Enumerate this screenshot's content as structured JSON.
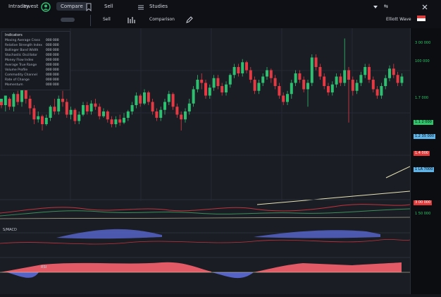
{
  "toolbar": {
    "tab_1": "Intraday",
    "tab_2": "Invest",
    "button": "Compare",
    "tab_3": "Sell",
    "tab_4": "Studies",
    "tab_5": "Comparison",
    "right_label": "Elliott Wave"
  },
  "info_panel": {
    "title": "Indicators",
    "rows": [
      {
        "label": "Moving Average Cross",
        "value": "000 000"
      },
      {
        "label": "Relative Strength Index",
        "value": "000 000"
      },
      {
        "label": "Bollinger Band Width",
        "value": "000 000"
      },
      {
        "label": "Stochastic Oscillator",
        "value": "000 000"
      },
      {
        "label": "Money Flow Index",
        "value": "000 000"
      },
      {
        "label": "Average True Range",
        "value": "000 000"
      },
      {
        "label": "Volume Profile",
        "value": "000 000"
      },
      {
        "label": "Commodity Channel",
        "value": "000 000"
      },
      {
        "label": "Rate of Change",
        "value": "000 000"
      },
      {
        "label": "Momentum",
        "value": "000 000"
      }
    ]
  },
  "price_scale": {
    "labels": [
      {
        "text": "3 00 000",
        "color": "#2ec46a",
        "bg": "#0b0d10"
      },
      {
        "text": "100 000",
        "color": "#2ec46a",
        "bg": "#0b0d10"
      },
      {
        "text": "1.7 000",
        "color": "#2ec46a",
        "bg": "#0b0d10"
      },
      {
        "text": "1.1 2 000",
        "color": "#0b0d10",
        "bg": "#2ec46a"
      },
      {
        "text": "1.2 35 000",
        "color": "#0b0d10",
        "bg": "#5fb3e6"
      },
      {
        "text": "1.4 000",
        "color": "#ffffff",
        "bg": "#e03a3a"
      },
      {
        "text": "1 LA 7000",
        "color": "#0b0d10",
        "bg": "#5fb3e6"
      },
      {
        "text": "3 00 000",
        "color": "#ffffff",
        "bg": "#e03a3a"
      },
      {
        "text": "1 50 000",
        "color": "#2ec46a",
        "bg": "#0b0d10"
      }
    ]
  },
  "sub_panels": {
    "osc_label": "S/MACD",
    "rsi_label": "RSI"
  },
  "colors": {
    "up": "#2fbf71",
    "down": "#e33a44",
    "line_up": "#3b8f5a",
    "line_down": "#c2333d",
    "fill_blue": "#5563c7",
    "fill_red": "#e25a66",
    "trend": "#e7e3b5"
  },
  "chart_data": {
    "type": "candlestick",
    "candles": [
      [
        0.0,
        0.57,
        0.6,
        0.55,
        0.58
      ],
      [
        0.0,
        0.58,
        0.56,
        0.54,
        0.57
      ],
      [
        0.01,
        0.56,
        0.62,
        0.52,
        0.6
      ],
      [
        0.02,
        0.6,
        0.55,
        0.53,
        0.61
      ],
      [
        0.03,
        0.55,
        0.63,
        0.52,
        0.64
      ],
      [
        0.04,
        0.63,
        0.58,
        0.56,
        0.65
      ],
      [
        0.05,
        0.58,
        0.66,
        0.55,
        0.67
      ],
      [
        0.06,
        0.66,
        0.6,
        0.57,
        0.67
      ],
      [
        0.07,
        0.6,
        0.54,
        0.5,
        0.62
      ],
      [
        0.08,
        0.54,
        0.47,
        0.44,
        0.56
      ],
      [
        0.09,
        0.47,
        0.49,
        0.45,
        0.52
      ],
      [
        0.1,
        0.49,
        0.44,
        0.4,
        0.5
      ],
      [
        0.11,
        0.44,
        0.48,
        0.43,
        0.5
      ],
      [
        0.12,
        0.48,
        0.55,
        0.46,
        0.56
      ],
      [
        0.13,
        0.55,
        0.52,
        0.5,
        0.6
      ],
      [
        0.14,
        0.52,
        0.6,
        0.5,
        0.62
      ],
      [
        0.15,
        0.6,
        0.58,
        0.55,
        0.65
      ],
      [
        0.16,
        0.58,
        0.5,
        0.48,
        0.6
      ],
      [
        0.17,
        0.5,
        0.53,
        0.47,
        0.55
      ],
      [
        0.18,
        0.53,
        0.46,
        0.44,
        0.54
      ],
      [
        0.19,
        0.46,
        0.5,
        0.44,
        0.52
      ],
      [
        0.2,
        0.5,
        0.56,
        0.49,
        0.58
      ],
      [
        0.21,
        0.56,
        0.52,
        0.5,
        0.58
      ],
      [
        0.22,
        0.52,
        0.57,
        0.5,
        0.59
      ],
      [
        0.23,
        0.57,
        0.55,
        0.53,
        0.6
      ],
      [
        0.24,
        0.55,
        0.49,
        0.47,
        0.57
      ],
      [
        0.25,
        0.49,
        0.52,
        0.48,
        0.54
      ],
      [
        0.26,
        0.52,
        0.47,
        0.45,
        0.53
      ],
      [
        0.27,
        0.47,
        0.44,
        0.42,
        0.49
      ],
      [
        0.28,
        0.44,
        0.47,
        0.42,
        0.49
      ],
      [
        0.29,
        0.47,
        0.45,
        0.43,
        0.5
      ],
      [
        0.3,
        0.45,
        0.48,
        0.44,
        0.51
      ],
      [
        0.31,
        0.48,
        0.52,
        0.46,
        0.53
      ],
      [
        0.32,
        0.52,
        0.56,
        0.5,
        0.58
      ],
      [
        0.33,
        0.56,
        0.62,
        0.54,
        0.64
      ],
      [
        0.34,
        0.62,
        0.57,
        0.55,
        0.63
      ],
      [
        0.35,
        0.57,
        0.64,
        0.56,
        0.66
      ],
      [
        0.36,
        0.64,
        0.58,
        0.56,
        0.65
      ],
      [
        0.37,
        0.58,
        0.52,
        0.5,
        0.6
      ],
      [
        0.38,
        0.52,
        0.48,
        0.46,
        0.54
      ],
      [
        0.39,
        0.48,
        0.53,
        0.46,
        0.55
      ],
      [
        0.4,
        0.53,
        0.58,
        0.5,
        0.6
      ],
      [
        0.41,
        0.58,
        0.63,
        0.56,
        0.65
      ],
      [
        0.42,
        0.63,
        0.55,
        0.53,
        0.64
      ],
      [
        0.43,
        0.55,
        0.5,
        0.48,
        0.57
      ],
      [
        0.44,
        0.5,
        0.47,
        0.4,
        0.52
      ],
      [
        0.45,
        0.47,
        0.52,
        0.45,
        0.54
      ],
      [
        0.46,
        0.52,
        0.57,
        0.5,
        0.6
      ],
      [
        0.47,
        0.57,
        0.66,
        0.55,
        0.68
      ],
      [
        0.48,
        0.66,
        0.72,
        0.64,
        0.75
      ],
      [
        0.49,
        0.72,
        0.7,
        0.66,
        0.76
      ],
      [
        0.5,
        0.7,
        0.62,
        0.6,
        0.72
      ],
      [
        0.51,
        0.62,
        0.67,
        0.6,
        0.69
      ],
      [
        0.52,
        0.67,
        0.73,
        0.65,
        0.75
      ],
      [
        0.53,
        0.73,
        0.68,
        0.66,
        0.75
      ],
      [
        0.54,
        0.68,
        0.64,
        0.62,
        0.7
      ],
      [
        0.55,
        0.64,
        0.69,
        0.62,
        0.71
      ],
      [
        0.56,
        0.69,
        0.75,
        0.67,
        0.76
      ],
      [
        0.57,
        0.75,
        0.8,
        0.73,
        0.82
      ],
      [
        0.58,
        0.8,
        0.76,
        0.74,
        0.82
      ],
      [
        0.59,
        0.76,
        0.83,
        0.74,
        0.85
      ],
      [
        0.6,
        0.83,
        0.78,
        0.76,
        0.84
      ],
      [
        0.61,
        0.78,
        0.72,
        0.7,
        0.8
      ],
      [
        0.62,
        0.72,
        0.65,
        0.63,
        0.74
      ],
      [
        0.63,
        0.65,
        0.7,
        0.63,
        0.72
      ],
      [
        0.64,
        0.7,
        0.74,
        0.68,
        0.76
      ],
      [
        0.65,
        0.74,
        0.78,
        0.72,
        0.8
      ],
      [
        0.66,
        0.78,
        0.73,
        0.7,
        0.79
      ],
      [
        0.67,
        0.73,
        0.68,
        0.66,
        0.75
      ],
      [
        0.68,
        0.68,
        0.62,
        0.6,
        0.7
      ],
      [
        0.69,
        0.62,
        0.58,
        0.56,
        0.64
      ],
      [
        0.7,
        0.58,
        0.63,
        0.56,
        0.65
      ],
      [
        0.71,
        0.63,
        0.7,
        0.6,
        0.72
      ],
      [
        0.72,
        0.7,
        0.76,
        0.68,
        0.78
      ],
      [
        0.73,
        0.76,
        0.72,
        0.7,
        0.78
      ],
      [
        0.74,
        0.72,
        0.66,
        0.64,
        0.74
      ],
      [
        0.75,
        0.66,
        0.7,
        0.55,
        0.72
      ],
      [
        0.76,
        0.7,
        0.86,
        0.68,
        0.88
      ],
      [
        0.77,
        0.86,
        0.8,
        0.78,
        0.88
      ],
      [
        0.78,
        0.8,
        0.74,
        0.72,
        0.82
      ],
      [
        0.79,
        0.74,
        0.68,
        0.66,
        0.76
      ],
      [
        0.8,
        0.68,
        0.64,
        0.62,
        0.7
      ],
      [
        0.81,
        0.64,
        0.69,
        0.62,
        0.71
      ],
      [
        0.82,
        0.69,
        0.74,
        0.67,
        0.76
      ],
      [
        0.83,
        0.74,
        0.7,
        0.68,
        0.76
      ],
      [
        0.84,
        0.7,
        0.78,
        0.68,
        0.98
      ],
      [
        0.85,
        0.78,
        0.72,
        0.45,
        0.8
      ],
      [
        0.86,
        0.72,
        0.65,
        0.62,
        0.74
      ],
      [
        0.87,
        0.65,
        0.7,
        0.63,
        0.72
      ],
      [
        0.88,
        0.7,
        0.75,
        0.68,
        0.77
      ],
      [
        0.89,
        0.75,
        0.8,
        0.73,
        0.82
      ],
      [
        0.9,
        0.8,
        0.72,
        0.7,
        0.82
      ],
      [
        0.91,
        0.72,
        0.66,
        0.64,
        0.74
      ],
      [
        0.92,
        0.66,
        0.62,
        0.6,
        0.68
      ],
      [
        0.93,
        0.62,
        0.68,
        0.6,
        0.7
      ],
      [
        0.94,
        0.68,
        0.73,
        0.66,
        0.75
      ],
      [
        0.95,
        0.73,
        0.79,
        0.71,
        0.81
      ],
      [
        0.96,
        0.79,
        0.75,
        0.73,
        0.82
      ],
      [
        0.97,
        0.75,
        0.7,
        0.68,
        0.77
      ],
      [
        0.98,
        0.7,
        0.74,
        0.68,
        0.76
      ]
    ]
  }
}
